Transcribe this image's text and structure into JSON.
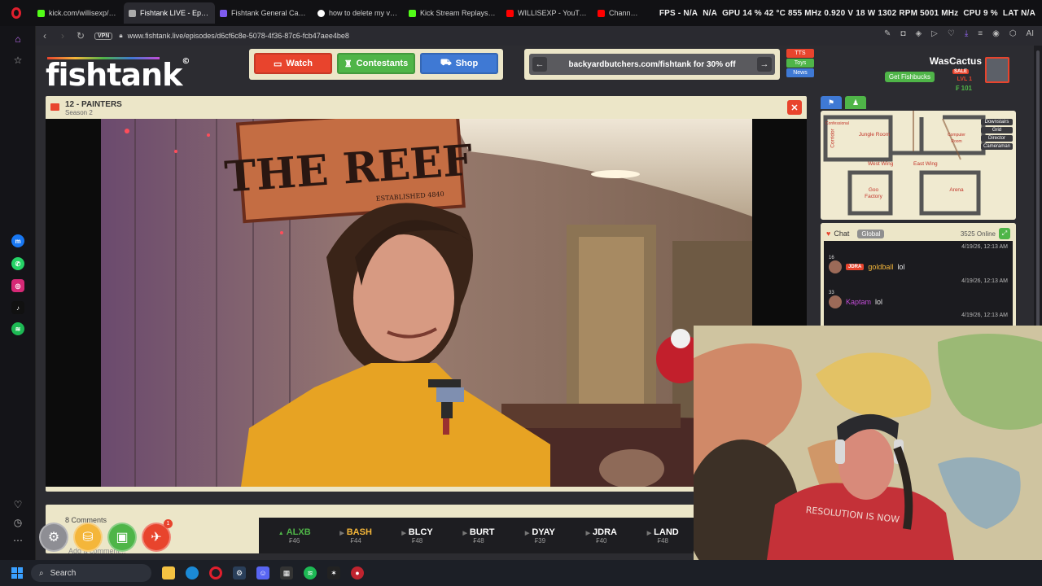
{
  "browser": {
    "tabs": [
      {
        "label": "kick.com/willisexp/videos",
        "icon_color": "#53fc18",
        "active": false
      },
      {
        "label": "Fishtank LIVE - Episod",
        "icon_color": "#aaaaaa",
        "active": true
      },
      {
        "label": "Fishtank General Casting",
        "icon_color": "#7e5bef",
        "active": false
      },
      {
        "label": "how to delete my vods on",
        "icon_color": "#ffffff",
        "active": false
      },
      {
        "label": "Kick Stream Replays / VO",
        "icon_color": "#53fc18",
        "active": false
      },
      {
        "label": "WILLISEXP - YouTube",
        "icon_color": "#ff0000",
        "active": false
      },
      {
        "label": "Channel content",
        "icon_color": "#ff0000",
        "active": false
      }
    ],
    "url": "www.fishtank.live/episodes/d6cf6c8e-5078-4f36-87c6-fcb47aee4be8",
    "vpn_label": "VPN"
  },
  "hwinfo": {
    "fps": "FPS - N/A",
    "na": "N/A",
    "gpu": "GPU 14 % 42 °C 855 MHz 0.920 V 18 W 1302 RPM 5001 MHz",
    "cpu": "CPU 9 %",
    "lat": "LAT N/A"
  },
  "site": {
    "logo": "fishtank",
    "logo_mark": "©",
    "nav": {
      "watch": "Watch",
      "contestants": "Contestants",
      "shop": "Shop"
    },
    "banner": "backyardbutchers.com/fishtank for 30% off",
    "side_tabs": [
      "TTS",
      "Toys",
      "News"
    ],
    "user": {
      "name": "WasCactus",
      "get_fishbucks": "Get Fishbucks",
      "sale": "SALE",
      "level": "LVL 1",
      "fishbucks": "₣ 101"
    }
  },
  "video": {
    "title": "12 - PAINTERS",
    "season": "Season 2",
    "sign_text": "THE REEF",
    "sign_sub": "ESTABLISHED 4840"
  },
  "map": {
    "rooms": [
      "Confessional",
      "Corridor",
      "Jungle Room",
      "Computer Room",
      "West Wing",
      "East Wing",
      "Goo Factory",
      "Arena"
    ],
    "legend": [
      "Downstairs",
      "Grid",
      "Director",
      "Cameraman"
    ]
  },
  "chat": {
    "title": "Chat",
    "scope": "Global",
    "online": "3525 Online",
    "messages": [
      {
        "timestamp": "4/19/26, 12:13 AM"
      },
      {
        "level": "16",
        "badge": "JDRA",
        "user": "goldball",
        "text": "lol",
        "timestamp": "4/19/26, 12:13 AM",
        "user_color": "#f4b63a"
      },
      {
        "level": "33",
        "user": "Kaptam",
        "text": "lol",
        "timestamp": "4/19/26, 12:13 AM",
        "user_color": "#c44dd8"
      }
    ]
  },
  "comments": {
    "count": "8 Comments",
    "placeholder": "Add a comment..."
  },
  "tools": {
    "notification_count": "1"
  },
  "contestants": [
    {
      "name": "ALXB",
      "value": "₣46",
      "state": "up"
    },
    {
      "name": "BASH",
      "value": "₣44",
      "state": "selected"
    },
    {
      "name": "BLCY",
      "value": "₣48",
      "state": ""
    },
    {
      "name": "BURT",
      "value": "₣48",
      "state": ""
    },
    {
      "name": "DYAY",
      "value": "₣39",
      "state": ""
    },
    {
      "name": "JDRA",
      "value": "₣40",
      "state": ""
    },
    {
      "name": "LAND",
      "value": "₣48",
      "state": ""
    }
  ],
  "webcam": {
    "shirt_text": "RESOLUTION IS NOW"
  },
  "taskbar": {
    "search_placeholder": "Search"
  },
  "colors": {
    "accent_red": "#e8442d",
    "accent_green": "#4fb548",
    "accent_blue": "#3f79d4",
    "panel_cream": "#ece6c8"
  }
}
